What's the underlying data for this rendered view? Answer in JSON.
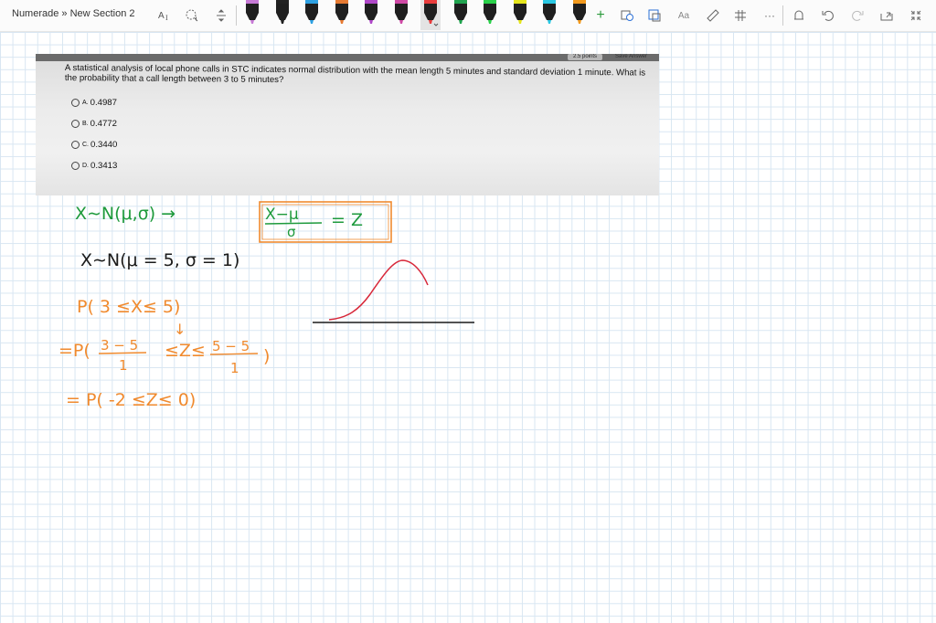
{
  "toolbar": {
    "breadcrumb": "Numerade » New Section 2",
    "tools": [
      "type-icon",
      "lasso-icon",
      "add-space-icon"
    ],
    "right_tools": [
      "add-pen-icon",
      "shape-icon",
      "ink-to-shape-icon",
      "ink-to-text-icon",
      "ruler-icon",
      "math-icon",
      "more-icon",
      "replay-icon",
      "undo-icon",
      "redo-icon",
      "share-icon",
      "fullscreen-icon"
    ],
    "pens": [
      {
        "color": "#c77ad6"
      },
      {
        "color": "#222222"
      },
      {
        "color": "#2ea1e3"
      },
      {
        "color": "#e67a32"
      },
      {
        "color": "#b048c9"
      },
      {
        "color": "#d04aa6"
      },
      {
        "color": "#e83c3c",
        "selected": true
      },
      {
        "color": "#21a34f"
      },
      {
        "color": "#2ad14a"
      },
      {
        "color": "#e5e51d"
      },
      {
        "color": "#2bc8e3"
      },
      {
        "color": "#f29a1e"
      }
    ],
    "more_symbol": "···"
  },
  "photo": {
    "points_badge": "2.5 points",
    "save_badge": "Save Answer",
    "question": "A statistical analysis of local phone calls in STC indicates normal distribution with the mean length 5 minutes and standard deviation 1 minute. What is the probability that a call length between 3 to 5 minutes?",
    "options": [
      {
        "letter": "A.",
        "value": "0.4987"
      },
      {
        "letter": "B.",
        "value": "0.4772"
      },
      {
        "letter": "C.",
        "value": "0.3440"
      },
      {
        "letter": "D.",
        "value": "0.3413"
      }
    ]
  },
  "ink": {
    "colors": {
      "green": "#1e9a3c",
      "black": "#1a1a1a",
      "orange": "#f08a2e",
      "red": "#d8283a"
    },
    "line1_left": "X∼N(μ,σ) →",
    "line1_num": "X−μ",
    "line1_den": "σ",
    "line1_eq": "= Z",
    "line2": "X∼N(μ = 5, σ = 1)",
    "line3": "P(   3  ≤X≤ 5)",
    "arrow": "↓",
    "line4_pre": "=P(",
    "line4_num1": "3 − 5",
    "line4_den1": "1",
    "line4_mid": "≤Z≤",
    "line4_num2": "5 − 5",
    "line4_den2": "1",
    "line4_post": ")",
    "line5": "= P( -2 ≤Z≤ 0)"
  }
}
